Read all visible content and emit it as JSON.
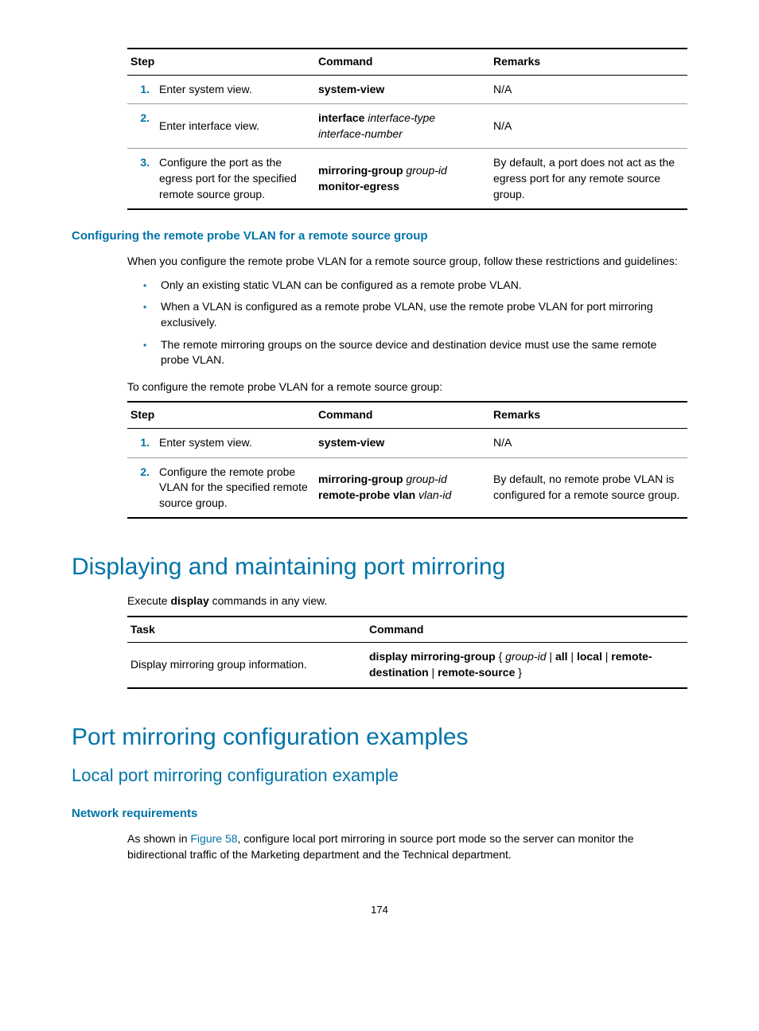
{
  "table1": {
    "headers": {
      "step": "Step",
      "command": "Command",
      "remarks": "Remarks"
    },
    "rows": [
      {
        "num": "1.",
        "step": "Enter system view.",
        "cmd_bold": "system-view",
        "cmd_italic": "",
        "remarks": "N/A"
      },
      {
        "num": "2.",
        "step": "Enter interface view.",
        "cmd_bold": "interface",
        "cmd_italic": " interface-type interface-number",
        "remarks": "N/A"
      },
      {
        "num": "3.",
        "step": "Configure the port as the egress port for the specified remote source group.",
        "cmd_bold_a": "mirroring-group",
        "cmd_italic_a": " group-id",
        "cmd_bold_b": " monitor-egress",
        "remarks": "By default, a port does not act as the egress port for any remote source group."
      }
    ]
  },
  "section1": {
    "heading": "Configuring the remote probe VLAN for a remote source group",
    "intro": "When you configure the remote probe VLAN for a remote source group, follow these restrictions and guidelines:",
    "bullets": [
      "Only an existing static VLAN can be configured as a remote probe VLAN.",
      "When a VLAN is configured as a remote probe VLAN, use the remote probe VLAN for port mirroring exclusively.",
      "The remote mirroring groups on the source device and destination device must use the same remote probe VLAN."
    ],
    "lead_in": "To configure the remote probe VLAN for a remote source group:"
  },
  "table2": {
    "headers": {
      "step": "Step",
      "command": "Command",
      "remarks": "Remarks"
    },
    "rows": [
      {
        "num": "1.",
        "step": "Enter system view.",
        "cmd_bold": "system-view",
        "remarks": "N/A"
      },
      {
        "num": "2.",
        "step": "Configure the remote probe VLAN for the specified remote source group.",
        "cmd_bold_a": "mirroring-group",
        "cmd_italic_a": " group-id",
        "cmd_bold_b": " remote-probe vlan",
        "cmd_italic_b": " vlan-id",
        "remarks": "By default, no remote probe VLAN is configured for a remote source group."
      }
    ]
  },
  "section2": {
    "heading": "Displaying and maintaining port mirroring",
    "para_pre": "Execute ",
    "para_bold": "display",
    "para_post": " commands in any view."
  },
  "table3": {
    "headers": {
      "task": "Task",
      "command": "Command"
    },
    "row": {
      "task": "Display mirroring group information.",
      "cmd_parts": {
        "b1": "display mirroring-group",
        "t1": " { ",
        "i1": "group-id",
        "t2": " | ",
        "b2": "all",
        "t3": " | ",
        "b3": "local",
        "t4": " | ",
        "b4": "remote-destination",
        "t5": " | ",
        "b5": "remote-source",
        "t6": " }"
      }
    }
  },
  "section3": {
    "h1": "Port mirroring configuration examples",
    "h2": "Local port mirroring configuration example",
    "h3": "Network requirements",
    "para_pre": "As shown in ",
    "linktext": "Figure 58",
    "para_post": ", configure local port mirroring in source port mode so the server can monitor the bidirectional traffic of the Marketing department and the Technical department."
  },
  "page": "174"
}
